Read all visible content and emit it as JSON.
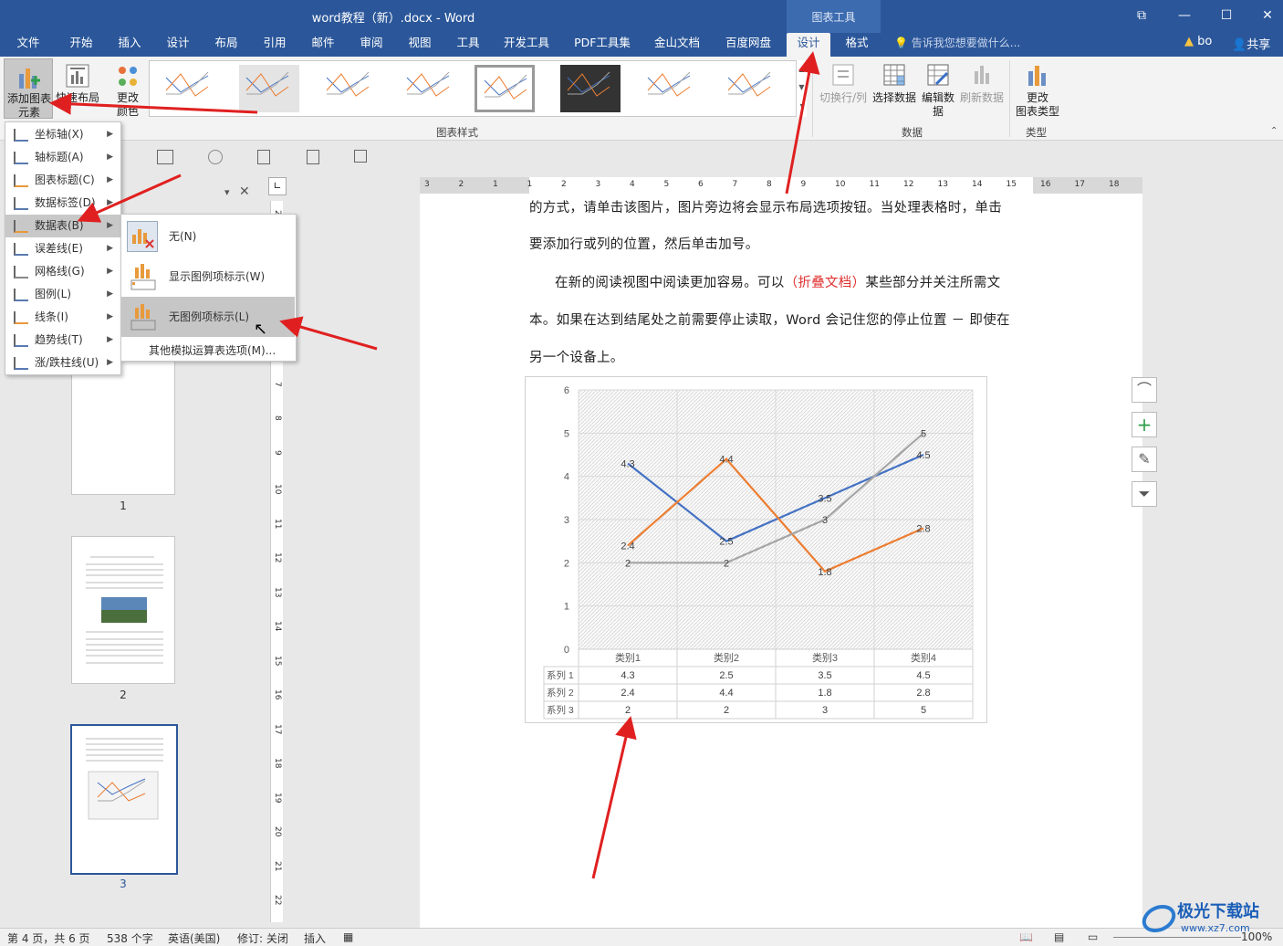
{
  "window": {
    "title": "word教程（新）.docx - Word",
    "context_group": "图表工具",
    "user": "bo",
    "share": "共享"
  },
  "tabs": [
    "文件",
    "开始",
    "插入",
    "设计",
    "布局",
    "引用",
    "邮件",
    "审阅",
    "视图",
    "工具",
    "开发工具",
    "PDF工具集",
    "金山文档",
    "百度网盘",
    "设计",
    "格式"
  ],
  "active_tab_index": 14,
  "tell_me": "告诉我您想要做什么...",
  "ribbon": {
    "add_chart_element": "添加图表",
    "add_chart_element_2": "元素",
    "quick_layout": "快速布局",
    "change_colors": "更改",
    "change_colors_2": "颜色",
    "chart_styles_group": "图表样式",
    "switch_row_col": "切换行/列",
    "select_data": "选择数据",
    "edit_data": "编辑数",
    "edit_data_2": "据",
    "refresh_data": "刷新数据",
    "data_group": "数据",
    "change_chart_type": "更改",
    "change_chart_type_2": "图表类型",
    "type_group": "类型"
  },
  "menu": {
    "items": [
      {
        "label": "坐标轴(X)",
        "icon": "axes-icon"
      },
      {
        "label": "轴标题(A)",
        "icon": "axis-title-icon"
      },
      {
        "label": "图表标题(C)",
        "icon": "chart-title-icon"
      },
      {
        "label": "数据标签(D)",
        "icon": "data-labels-icon"
      },
      {
        "label": "数据表(B)",
        "icon": "data-table-icon"
      },
      {
        "label": "误差线(E)",
        "icon": "error-bars-icon"
      },
      {
        "label": "网格线(G)",
        "icon": "gridlines-icon"
      },
      {
        "label": "图例(L)",
        "icon": "legend-icon"
      },
      {
        "label": "线条(I)",
        "icon": "lines-icon"
      },
      {
        "label": "趋势线(T)",
        "icon": "trendline-icon"
      },
      {
        "label": "涨/跌柱线(U)",
        "icon": "up-down-bars-icon"
      }
    ],
    "highlighted_index": 4,
    "submenu": {
      "items": [
        "无(N)",
        "显示图例项标示(W)",
        "无图例项标示(L)"
      ],
      "highlighted_index": 2,
      "more": "其他模拟运算表选项(M)..."
    }
  },
  "nav": {
    "pages": [
      "1",
      "2",
      "3"
    ],
    "selected": "3"
  },
  "ruler": {
    "h": [
      "3",
      "2",
      "1",
      "1",
      "2",
      "3",
      "4",
      "5",
      "6",
      "7",
      "8",
      "9",
      "10",
      "11",
      "12",
      "13",
      "14",
      "15",
      "16",
      "17",
      "18"
    ],
    "v": [
      "2",
      "3",
      "4",
      "5",
      "6",
      "7",
      "8",
      "9",
      "10",
      "11",
      "12",
      "13",
      "14",
      "15",
      "16",
      "17",
      "18",
      "19",
      "20",
      "21",
      "22"
    ]
  },
  "document": {
    "line1": "的方式，请单击该图片，图片旁边将会显示布局选项按钮。当处理表格时，单击",
    "line2": "要添加行或列的位置，然后单击加号。",
    "line3a": "在新的阅读视图中阅读更加容易。可以",
    "line3b": "（折叠文档）",
    "line3c": "某些部分并关注所需文",
    "line4": "本。如果在达到结尾处之前需要停止读取，Word 会记住您的停止位置 － 即使在",
    "line5": "另一个设备上。"
  },
  "chart_data": {
    "type": "line",
    "categories": [
      "类别1",
      "类别2",
      "类别3",
      "类别4"
    ],
    "series": [
      {
        "name": "系列 1",
        "values": [
          4.3,
          2.5,
          3.5,
          4.5
        ],
        "color": "#4472c4"
      },
      {
        "name": "系列 2",
        "values": [
          2.4,
          4.4,
          1.8,
          2.8
        ],
        "color": "#ed7d31"
      },
      {
        "name": "系列 3",
        "values": [
          2,
          2,
          3,
          5
        ],
        "color": "#a5a5a5"
      }
    ],
    "ylim": [
      0,
      6
    ],
    "yticks": [
      "0",
      "1",
      "2",
      "3",
      "4",
      "5",
      "6"
    ],
    "data_table": true,
    "grid": true
  },
  "status": {
    "page": "第 4 页，共 6 页",
    "words": "538 个字",
    "lang": "英语(美国)",
    "track": "修订: 关闭",
    "mode": "插入",
    "zoom": "100%"
  },
  "watermark": "极光下载站",
  "watermark_url": "www.xz7.com"
}
